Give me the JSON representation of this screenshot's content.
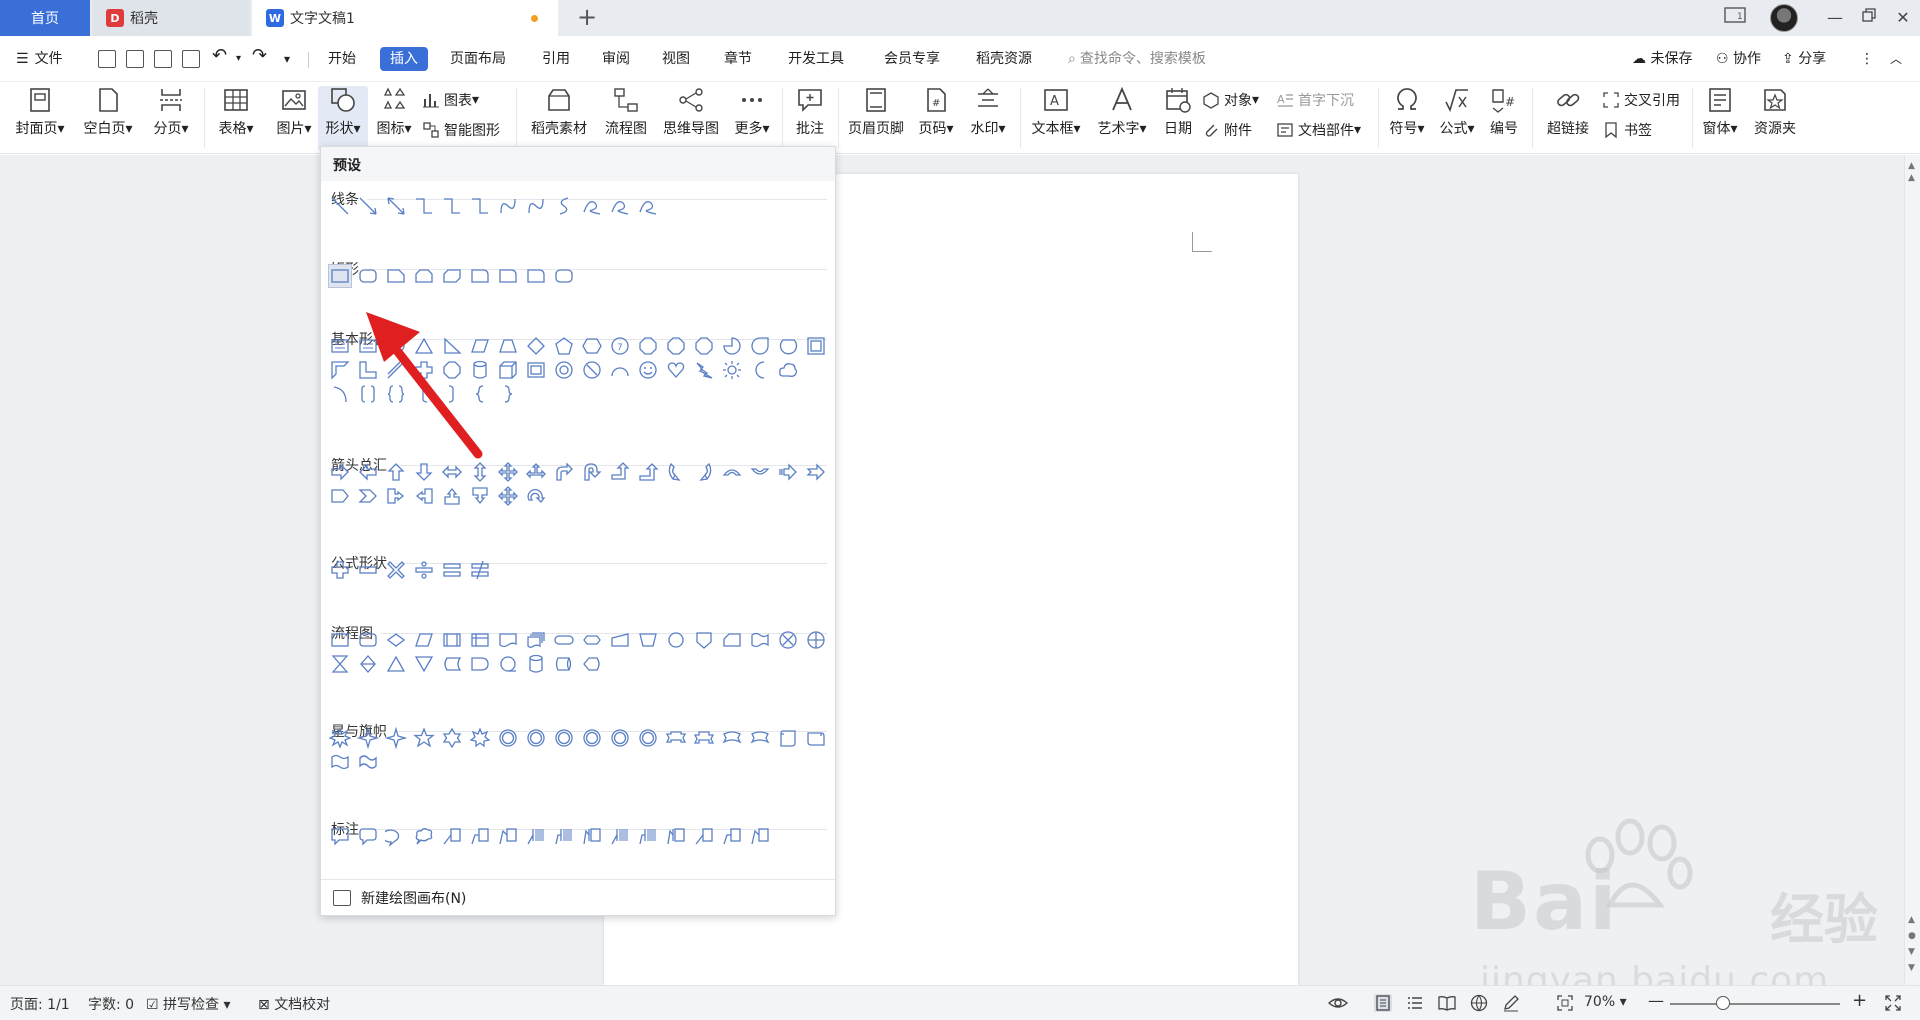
{
  "titlebar": {
    "tabs": [
      {
        "label": "首页"
      },
      {
        "label": "稻壳"
      },
      {
        "label": "文字文稿1"
      }
    ]
  },
  "menu": {
    "file": "文件",
    "items": [
      "开始",
      "插入",
      "页面布局",
      "引用",
      "审阅",
      "视图",
      "章节",
      "开发工具",
      "会员专享",
      "稻壳资源"
    ],
    "search_placeholder": "查找命令、搜索模板",
    "right": [
      "未保存",
      "协作",
      "分享"
    ]
  },
  "ribbon": {
    "big": [
      "封面页",
      "空白页",
      "分页",
      "表格",
      "图片",
      "形状",
      "图标",
      "稻壳素材",
      "流程图",
      "思维导图",
      "更多",
      "批注",
      "页眉页脚",
      "页码",
      "水印",
      "文本框",
      "艺术字",
      "日期",
      "符号",
      "公式",
      "编号",
      "超链接",
      "窗体",
      "资源夹"
    ],
    "small": {
      "chart": "图表",
      "smart": "智能图形",
      "object": "对象",
      "attach": "附件",
      "dropcap": "首字下沉",
      "docpart": "文档部件",
      "crossref": "交叉引用",
      "bookmark": "书签"
    }
  },
  "dropdown": {
    "preset": "预设",
    "categories": [
      "线条",
      "矩形",
      "基本形状",
      "箭头总汇",
      "公式形状",
      "流程图",
      "星与旗帜",
      "标注"
    ],
    "footer": "新建绘图画布(N)"
  },
  "watermark": {
    "brand": "Bai",
    "brand2": "经验",
    "url": "jingyan.baidu.com"
  },
  "status": {
    "page": "页面: 1/1",
    "words": "字数: 0",
    "spell": "拼写检查",
    "proof": "文档校对",
    "zoom": "70%"
  },
  "colors": {
    "accent": "#3a6fd8",
    "shape_stroke": "#5a7fc4",
    "annotation": "#e02020"
  }
}
